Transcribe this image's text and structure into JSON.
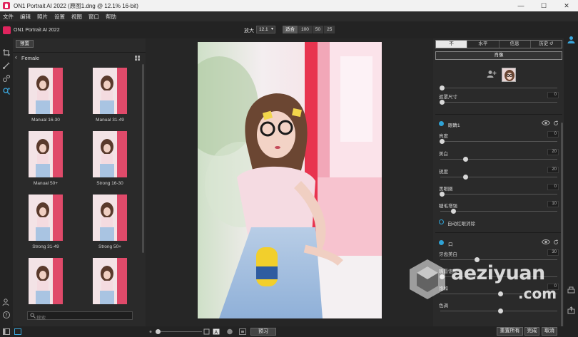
{
  "window": {
    "title": "ON1 Portrait AI 2022 (原图1.dng @ 12.1% 16-bit)",
    "controls": [
      "—",
      "☐",
      "✕"
    ]
  },
  "menu": [
    "文件",
    "编辑",
    "照片",
    "设置",
    "视图",
    "窗口",
    "帮助"
  ],
  "header": {
    "app_name": "ON1 Portrait AI 2022",
    "zoom_label": "放大",
    "zoom_value": "12.1",
    "zoom_buttons": [
      "适合",
      "100",
      "50",
      "25"
    ]
  },
  "left_panel": {
    "tab": "预置",
    "category": "Female",
    "presets": [
      "Manual 16-30",
      "Manual 31-49",
      "Manual 50+",
      "Strong 16-30",
      "Strong 31-49",
      "Strong 50+",
      "",
      ""
    ],
    "search_placeholder": "搜索"
  },
  "right_panel": {
    "tabs": [
      "不",
      "水平",
      "信息",
      "历史"
    ],
    "active_tab_index": 0,
    "face_button": "肖像",
    "controls_top": [
      {
        "label": "",
        "value": "",
        "pos": 0.0
      },
      {
        "label": "遮罩尺寸",
        "value": "0",
        "pos": 0.0
      }
    ],
    "section1": {
      "title": "眼睛1",
      "controls": [
        {
          "label": "亮度",
          "value": "0",
          "pos": 0.0
        },
        {
          "label": "美白",
          "value": "20",
          "pos": 0.2
        },
        {
          "label": "锐度",
          "value": "20",
          "pos": 0.2
        },
        {
          "label": "黑眼圈",
          "value": "0",
          "pos": 0.0
        },
        {
          "label": "睫毛增强",
          "value": "10",
          "pos": 0.1
        }
      ],
      "radio_label": "自动红眼消除"
    },
    "section2": {
      "title": "口",
      "controls": [
        {
          "label": "牙齿美白",
          "value": "30",
          "pos": 0.3
        },
        {
          "label": "嘴唇饱和",
          "value": "",
          "pos": 0.0
        },
        {
          "label": "饱和",
          "value": "0",
          "pos": 0.5
        },
        {
          "label": "色调",
          "value": "",
          "pos": 0.5
        }
      ]
    }
  },
  "bottom": {
    "preview_button": "预习",
    "reset_all": "重置所有",
    "done": "完成",
    "cancel": "取消"
  },
  "watermark": {
    "brand": "aeziyuan",
    "tld": ".com"
  },
  "colors": {
    "accent": "#2fa3d6",
    "brand": "#e0245e"
  }
}
